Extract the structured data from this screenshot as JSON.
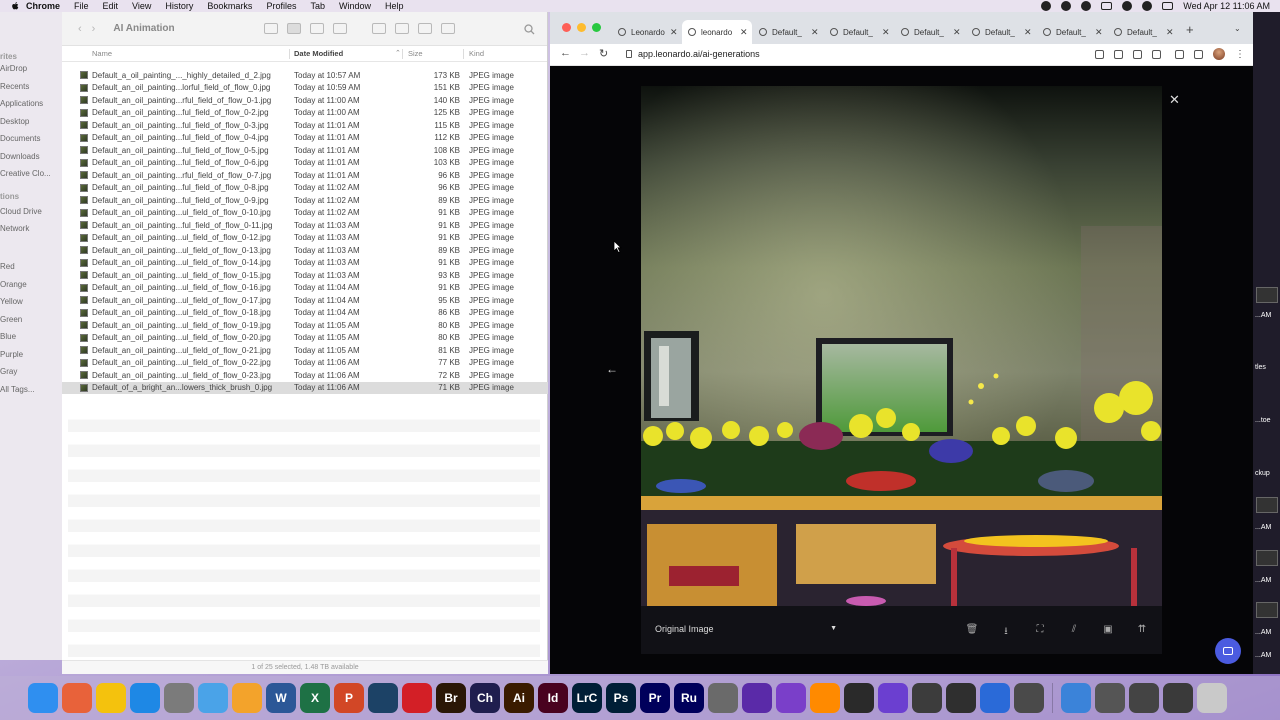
{
  "menubar": {
    "app_name": "Chrome",
    "items": [
      "File",
      "Edit",
      "View",
      "History",
      "Bookmarks",
      "Profiles",
      "Tab",
      "Window",
      "Help"
    ],
    "clock": "Wed Apr 12  11:06 AM"
  },
  "desktop_sidebar": {
    "items": [
      "rites",
      "AirDrop",
      "Recents",
      "Applications",
      "Desktop",
      "Documents",
      "Downloads",
      "Creative Clo...",
      "tions",
      "Cloud Drive",
      "Network",
      "Red",
      "Orange",
      "Yellow",
      "Green",
      "Blue",
      "Purple",
      "Gray",
      "All Tags..."
    ]
  },
  "finder": {
    "title": "AI Animation",
    "columns": {
      "name": "Name",
      "date": "Date Modified",
      "size": "Size",
      "kind": "Kind"
    },
    "files": [
      {
        "name": "Default_a_oil_painting_..._highly_detailed_d_2.jpg",
        "date": "Today at 10:57 AM",
        "size": "173 KB",
        "kind": "JPEG image"
      },
      {
        "name": "Default_an_oil_painting...lorful_field_of_flow_0.jpg",
        "date": "Today at 10:59 AM",
        "size": "151 KB",
        "kind": "JPEG image"
      },
      {
        "name": "Default_an_oil_painting...rful_field_of_flow_0-1.jpg",
        "date": "Today at 11:00 AM",
        "size": "140 KB",
        "kind": "JPEG image"
      },
      {
        "name": "Default_an_oil_painting...ful_field_of_flow_0-2.jpg",
        "date": "Today at 11:00 AM",
        "size": "125 KB",
        "kind": "JPEG image"
      },
      {
        "name": "Default_an_oil_painting...ful_field_of_flow_0-3.jpg",
        "date": "Today at 11:01 AM",
        "size": "115 KB",
        "kind": "JPEG image"
      },
      {
        "name": "Default_an_oil_painting...ful_field_of_flow_0-4.jpg",
        "date": "Today at 11:01 AM",
        "size": "112 KB",
        "kind": "JPEG image"
      },
      {
        "name": "Default_an_oil_painting...ful_field_of_flow_0-5.jpg",
        "date": "Today at 11:01 AM",
        "size": "108 KB",
        "kind": "JPEG image"
      },
      {
        "name": "Default_an_oil_painting...ful_field_of_flow_0-6.jpg",
        "date": "Today at 11:01 AM",
        "size": "103 KB",
        "kind": "JPEG image"
      },
      {
        "name": "Default_an_oil_painting...rful_field_of_flow_0-7.jpg",
        "date": "Today at 11:01 AM",
        "size": "96 KB",
        "kind": "JPEG image"
      },
      {
        "name": "Default_an_oil_painting...ful_field_of_flow_0-8.jpg",
        "date": "Today at 11:02 AM",
        "size": "96 KB",
        "kind": "JPEG image"
      },
      {
        "name": "Default_an_oil_painting...ful_field_of_flow_0-9.jpg",
        "date": "Today at 11:02 AM",
        "size": "89 KB",
        "kind": "JPEG image"
      },
      {
        "name": "Default_an_oil_painting...ul_field_of_flow_0-10.jpg",
        "date": "Today at 11:02 AM",
        "size": "91 KB",
        "kind": "JPEG image"
      },
      {
        "name": "Default_an_oil_painting...ful_field_of_flow_0-11.jpg",
        "date": "Today at 11:03 AM",
        "size": "91 KB",
        "kind": "JPEG image"
      },
      {
        "name": "Default_an_oil_painting...ul_field_of_flow_0-12.jpg",
        "date": "Today at 11:03 AM",
        "size": "91 KB",
        "kind": "JPEG image"
      },
      {
        "name": "Default_an_oil_painting...ul_field_of_flow_0-13.jpg",
        "date": "Today at 11:03 AM",
        "size": "89 KB",
        "kind": "JPEG image"
      },
      {
        "name": "Default_an_oil_painting...ul_field_of_flow_0-14.jpg",
        "date": "Today at 11:03 AM",
        "size": "91 KB",
        "kind": "JPEG image"
      },
      {
        "name": "Default_an_oil_painting...ul_field_of_flow_0-15.jpg",
        "date": "Today at 11:03 AM",
        "size": "93 KB",
        "kind": "JPEG image"
      },
      {
        "name": "Default_an_oil_painting...ul_field_of_flow_0-16.jpg",
        "date": "Today at 11:04 AM",
        "size": "91 KB",
        "kind": "JPEG image"
      },
      {
        "name": "Default_an_oil_painting...ul_field_of_flow_0-17.jpg",
        "date": "Today at 11:04 AM",
        "size": "95 KB",
        "kind": "JPEG image"
      },
      {
        "name": "Default_an_oil_painting...ul_field_of_flow_0-18.jpg",
        "date": "Today at 11:04 AM",
        "size": "86 KB",
        "kind": "JPEG image"
      },
      {
        "name": "Default_an_oil_painting...ul_field_of_flow_0-19.jpg",
        "date": "Today at 11:05 AM",
        "size": "80 KB",
        "kind": "JPEG image"
      },
      {
        "name": "Default_an_oil_painting...ul_field_of_flow_0-20.jpg",
        "date": "Today at 11:05 AM",
        "size": "80 KB",
        "kind": "JPEG image"
      },
      {
        "name": "Default_an_oil_painting...ul_field_of_flow_0-21.jpg",
        "date": "Today at 11:05 AM",
        "size": "81 KB",
        "kind": "JPEG image"
      },
      {
        "name": "Default_an_oil_painting...ul_field_of_flow_0-22.jpg",
        "date": "Today at 11:06 AM",
        "size": "77 KB",
        "kind": "JPEG image"
      },
      {
        "name": "Default_an_oil_painting...ul_field_of_flow_0-23.jpg",
        "date": "Today at 11:06 AM",
        "size": "72 KB",
        "kind": "JPEG image"
      },
      {
        "name": "Default_of_a_bright_an...lowers_thick_brush_0.jpg",
        "date": "Today at 11:06 AM",
        "size": "71 KB",
        "kind": "JPEG image",
        "selected": true
      }
    ],
    "status": "1 of 25 selected, 1.48 TB available"
  },
  "browser": {
    "tabs": [
      {
        "label": "Leonardo",
        "active": false
      },
      {
        "label": "leonardo",
        "active": true
      },
      {
        "label": "Default_",
        "active": false
      },
      {
        "label": "Default_",
        "active": false
      },
      {
        "label": "Default_",
        "active": false
      },
      {
        "label": "Default_",
        "active": false
      },
      {
        "label": "Default_",
        "active": false
      },
      {
        "label": "Default_",
        "active": false
      }
    ],
    "url": "app.leonardo.ai/ai-generations",
    "image_viewer": {
      "version_select": "Original Image"
    }
  },
  "right_edge": {
    "labels": [
      "...AM",
      "...AM",
      "...AM",
      "...AM",
      "...AM",
      "...AM",
      "tles",
      "...toe",
      "ckup"
    ]
  },
  "dock": {
    "apps": [
      {
        "name": "Finder",
        "glyph": "",
        "color": "#2f8ff0"
      },
      {
        "name": "Launchpad",
        "glyph": "",
        "color": "#e8623a"
      },
      {
        "name": "Chrome",
        "glyph": "",
        "color": "#f4c20d"
      },
      {
        "name": "Safari",
        "glyph": "",
        "color": "#1e88e5"
      },
      {
        "name": "System Settings",
        "glyph": "",
        "color": "#7b7b7b"
      },
      {
        "name": "Preview",
        "glyph": "",
        "color": "#4aa3e8"
      },
      {
        "name": "Pages",
        "glyph": "",
        "color": "#f3a32b"
      },
      {
        "name": "Word",
        "glyph": "W",
        "color": "#2b5797"
      },
      {
        "name": "Excel",
        "glyph": "X",
        "color": "#1e7145"
      },
      {
        "name": "PowerPoint",
        "glyph": "P",
        "color": "#d24726"
      },
      {
        "name": "Bridge",
        "glyph": "",
        "color": "#1c4266"
      },
      {
        "name": "Acrobat",
        "glyph": "",
        "color": "#d31f26"
      },
      {
        "name": "Br",
        "glyph": "Br",
        "color": "#2a1706"
      },
      {
        "name": "Ch",
        "glyph": "Ch",
        "color": "#1f1e4e"
      },
      {
        "name": "Ai",
        "glyph": "Ai",
        "color": "#3a1b00"
      },
      {
        "name": "Id",
        "glyph": "Id",
        "color": "#49021f"
      },
      {
        "name": "LrC",
        "glyph": "LrC",
        "color": "#001e36"
      },
      {
        "name": "Ps",
        "glyph": "Ps",
        "color": "#001e36"
      },
      {
        "name": "Pr",
        "glyph": "Pr",
        "color": "#00005b"
      },
      {
        "name": "Ru",
        "glyph": "Ru",
        "color": "#00005b"
      },
      {
        "name": "Compressor",
        "glyph": "",
        "color": "#6a6a6a"
      },
      {
        "name": "Affinity",
        "glyph": "",
        "color": "#5a2aa8"
      },
      {
        "name": "Logic",
        "glyph": "",
        "color": "#7a3fc9"
      },
      {
        "name": "GarageBand",
        "glyph": "",
        "color": "#ff8a00"
      },
      {
        "name": "Final Cut",
        "glyph": "",
        "color": "#2a2a2a"
      },
      {
        "name": "iMovie",
        "glyph": "",
        "color": "#6b3fd0"
      },
      {
        "name": "Motion",
        "glyph": "",
        "color": "#3c3c3c"
      },
      {
        "name": "App 1",
        "glyph": "",
        "color": "#2f2f2f"
      },
      {
        "name": "App 2",
        "glyph": "",
        "color": "#2a6ad8"
      },
      {
        "name": "App 3",
        "glyph": "",
        "color": "#4a4a4a"
      },
      {
        "name": "Folder",
        "glyph": "",
        "color": "#3b83d9"
      },
      {
        "name": "Stack 1",
        "glyph": "",
        "color": "#555"
      },
      {
        "name": "Stack 2",
        "glyph": "",
        "color": "#444"
      },
      {
        "name": "Stack 3",
        "glyph": "",
        "color": "#3a3a3a"
      },
      {
        "name": "Trash",
        "glyph": "",
        "color": "#c9c9c9"
      }
    ]
  }
}
